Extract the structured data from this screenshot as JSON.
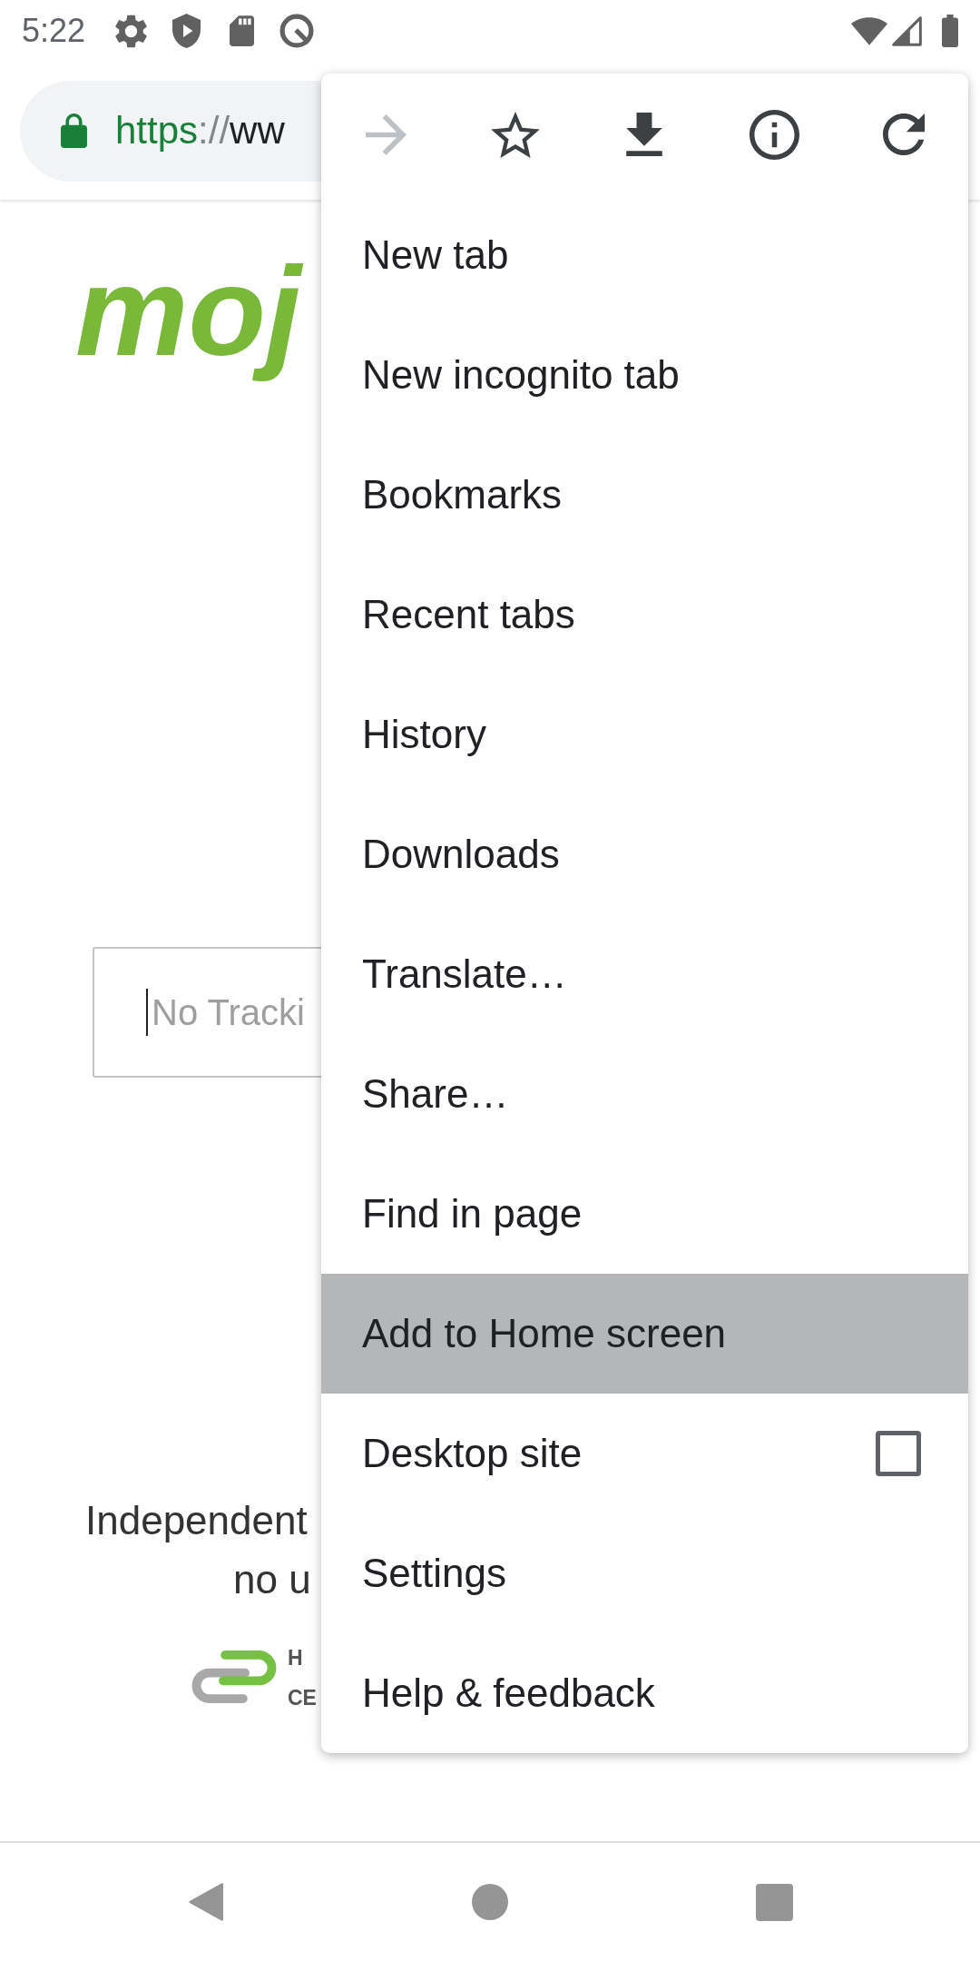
{
  "status_bar": {
    "time": "5:22"
  },
  "address_bar": {
    "scheme": "https",
    "separator": "://",
    "host": "ww"
  },
  "page": {
    "logo": "moj",
    "tracking_field": {
      "placeholder": "No Tracki",
      "focused": true
    },
    "tagline": [
      "Independent",
      "no u"
    ],
    "badge": [
      "H",
      "CE"
    ]
  },
  "menu": {
    "toolbar": [
      {
        "kind": "forward",
        "disabled": true
      },
      {
        "kind": "bookmark",
        "disabled": false
      },
      {
        "kind": "download",
        "disabled": false
      },
      {
        "kind": "info",
        "disabled": false
      },
      {
        "kind": "reload",
        "disabled": false
      }
    ],
    "items": [
      {
        "kind": "plain",
        "label": "New tab",
        "selected": false
      },
      {
        "kind": "plain",
        "label": "New incognito tab",
        "selected": false
      },
      {
        "kind": "plain",
        "label": "Bookmarks",
        "selected": false
      },
      {
        "kind": "plain",
        "label": "Recent tabs",
        "selected": false
      },
      {
        "kind": "plain",
        "label": "History",
        "selected": false
      },
      {
        "kind": "plain",
        "label": "Downloads",
        "selected": false
      },
      {
        "kind": "plain",
        "label": "Translate…",
        "selected": false
      },
      {
        "kind": "plain",
        "label": "Share…",
        "selected": false
      },
      {
        "kind": "plain",
        "label": "Find in page",
        "selected": false
      },
      {
        "kind": "plain",
        "label": "Add to Home screen",
        "selected": true
      },
      {
        "kind": "checkbox",
        "label": "Desktop site",
        "selected": false,
        "checked": false
      },
      {
        "kind": "plain",
        "label": "Settings",
        "selected": false
      },
      {
        "kind": "plain",
        "label": "Help & feedback",
        "selected": false
      }
    ]
  }
}
